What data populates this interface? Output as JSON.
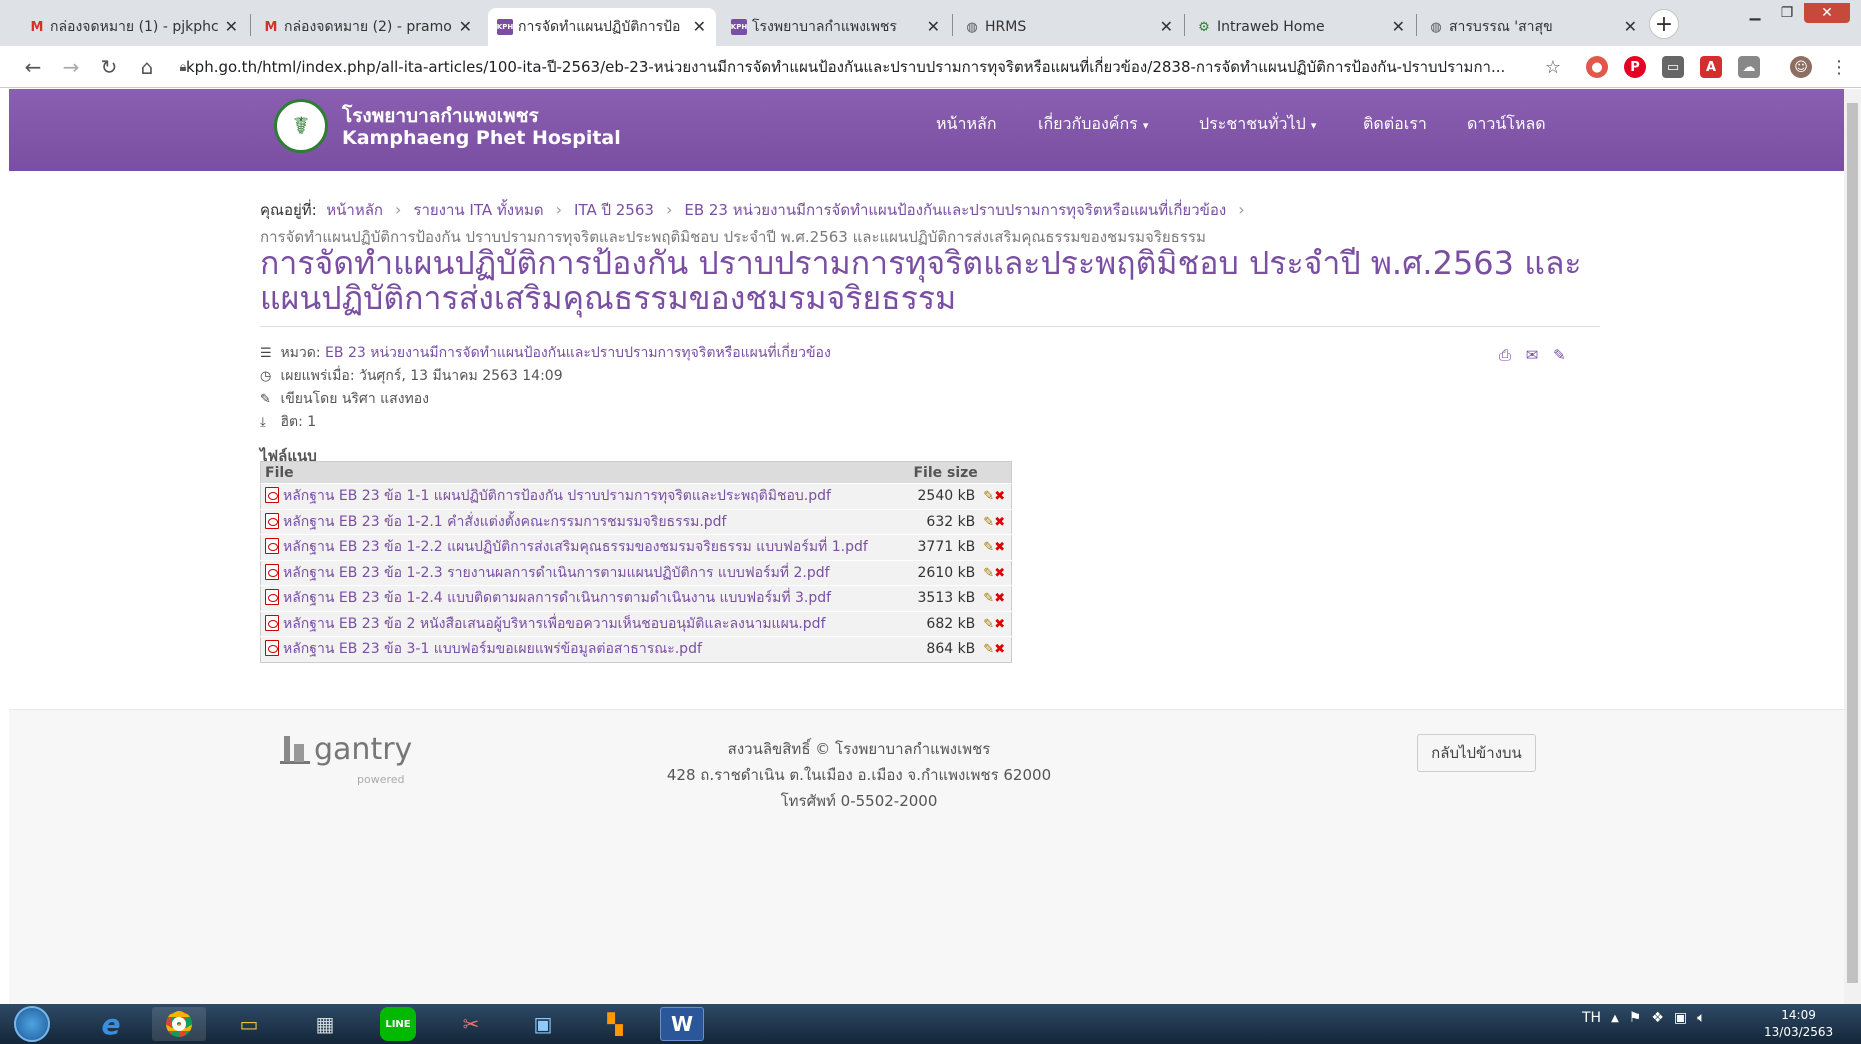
{
  "browser": {
    "tabs": [
      {
        "icon": "gmail-icon",
        "title": "กล่องจดหมาย (1) - pjkphc",
        "active": false
      },
      {
        "icon": "gmail-icon",
        "title": "กล่องจดหมาย (2) - pramo",
        "active": false
      },
      {
        "icon": "kph-icon",
        "title": "การจัดทำแผนปฏิบัติการป้อ",
        "active": true
      },
      {
        "icon": "kph-icon",
        "title": "โรงพยาบาลกำแพงเพชร",
        "active": false
      },
      {
        "icon": "globe-icon",
        "title": "HRMS",
        "active": false
      },
      {
        "icon": "intraweb-icon",
        "title": "Intraweb Home",
        "active": false
      },
      {
        "icon": "globe-icon",
        "title": "สารบรรณ 'สาสุข",
        "active": false
      }
    ],
    "url": "kph.go.th/html/index.php/all-ita-articles/100-ita-ปี-2563/eb-23-หน่วยงานมีการจัดทำแผนป้องกันและปราบปรามการทุจริตหรือแผนที่เกี่ยวข้อง/2838-การจัดทำแผนปฏิบัติการป้องกัน-ปราบปรามกา..."
  },
  "site": {
    "name_th": "โรงพยาบาลกำแพงเพชร",
    "name_en": "Kamphaeng Phet Hospital",
    "menu": [
      "หน้าหลัก",
      "เกี่ยวกับองค์กร",
      "ประชาชนทั่วไป",
      "ติดต่อเรา",
      "ดาวน์โหลด"
    ]
  },
  "breadcrumb": {
    "prefix": "คุณอยู่ที่:",
    "items": [
      "หน้าหลัก",
      "รายงาน ITA ทั้งหมด",
      "ITA ปี 2563",
      "EB 23 หน่วยงานมีการจัดทำแผนป้องกันและปราบปรามการทุจริตหรือแผนที่เกี่ยวข้อง"
    ],
    "current": "การจัดทำแผนปฏิบัติการป้องกัน ปราบปรามการทุจริตและประพฤติมิชอบ ประจำปี พ.ศ.2563 และแผนปฏิบัติการส่งเสริมคุณธรรมของชมรมจริยธรรม"
  },
  "article": {
    "title": "การจัดทำแผนปฏิบัติการป้องกัน ปราบปรามการทุจริตและประพฤติมิชอบ ประจำปี พ.ศ.2563 และแผนปฏิบัติการส่งเสริมคุณธรรมของชมรมจริยธรรม",
    "category_label": "หมวด:",
    "category": "EB 23 หน่วยงานมีการจัดทำแผนป้องกันและปราบปรามการทุจริตหรือแผนที่เกี่ยวข้อง",
    "published": "เผยแพร่เมื่อ: วันศุกร์, 13 มีนาคม 2563 14:09",
    "author": "เขียนโดย นริศา แสงทอง",
    "hits": "ฮิต: 1"
  },
  "attachments": {
    "label": "ไฟล์แนบ",
    "col_file": "File",
    "col_size": "File size",
    "rows": [
      {
        "file": "หลักฐาน EB 23 ข้อ 1-1 แผนปฏิบัติการป้องกัน ปราบปรามการทุจริตและประพฤติมิชอบ.pdf",
        "size": "2540 kB"
      },
      {
        "file": "หลักฐาน EB 23 ข้อ 1-2.1 คำสั่งแต่งตั้งคณะกรรมการชมรมจริยธรรม.pdf",
        "size": "632 kB"
      },
      {
        "file": "หลักฐาน EB 23 ข้อ 1-2.2 แผนปฏิบัติการส่งเสริมคุณธรรมของชมรมจริยธรรม แบบฟอร์มที่ 1.pdf",
        "size": "3771 kB"
      },
      {
        "file": "หลักฐาน EB 23 ข้อ 1-2.3 รายงานผลการดำเนินการตามแผนปฏิบัติการ แบบฟอร์มที่ 2.pdf",
        "size": "2610 kB"
      },
      {
        "file": "หลักฐาน EB 23 ข้อ 1-2.4 แบบติดตามผลการดำเนินการตามดำเนินงาน แบบฟอร์มที่ 3.pdf",
        "size": "3513 kB"
      },
      {
        "file": "หลักฐาน EB 23 ข้อ 2 หนังสือเสนอผู้บริหารเพื่อขอความเห็นชอบอนุมัติและลงนามแผน.pdf",
        "size": "682 kB"
      },
      {
        "file": "หลักฐาน EB 23 ข้อ 3-1 แบบฟอร์มขอเผยแพร่ข้อมูลต่อสาธารณะ.pdf",
        "size": "864 kB"
      }
    ]
  },
  "footer": {
    "brand": "gantry",
    "brand_sub": "powered",
    "copyright": "สงวนลิขสิทธิ์ © โรงพยาบาลกำแพงเพชร",
    "address": "428 ถ.ราชดำเนิน ต.ในเมือง อ.เมือง จ.กำแพงเพชร 62000",
    "phone": "โทรศัพท์ 0-5502-2000",
    "back_to_top": "กลับไปข้างบน"
  },
  "taskbar": {
    "lang": "TH",
    "time": "14:09",
    "date": "13/03/2563"
  },
  "colors": {
    "brand_purple": "#7a4ea2",
    "header_purple": "#8a5fb0",
    "taskbar": "#1f3a55"
  }
}
